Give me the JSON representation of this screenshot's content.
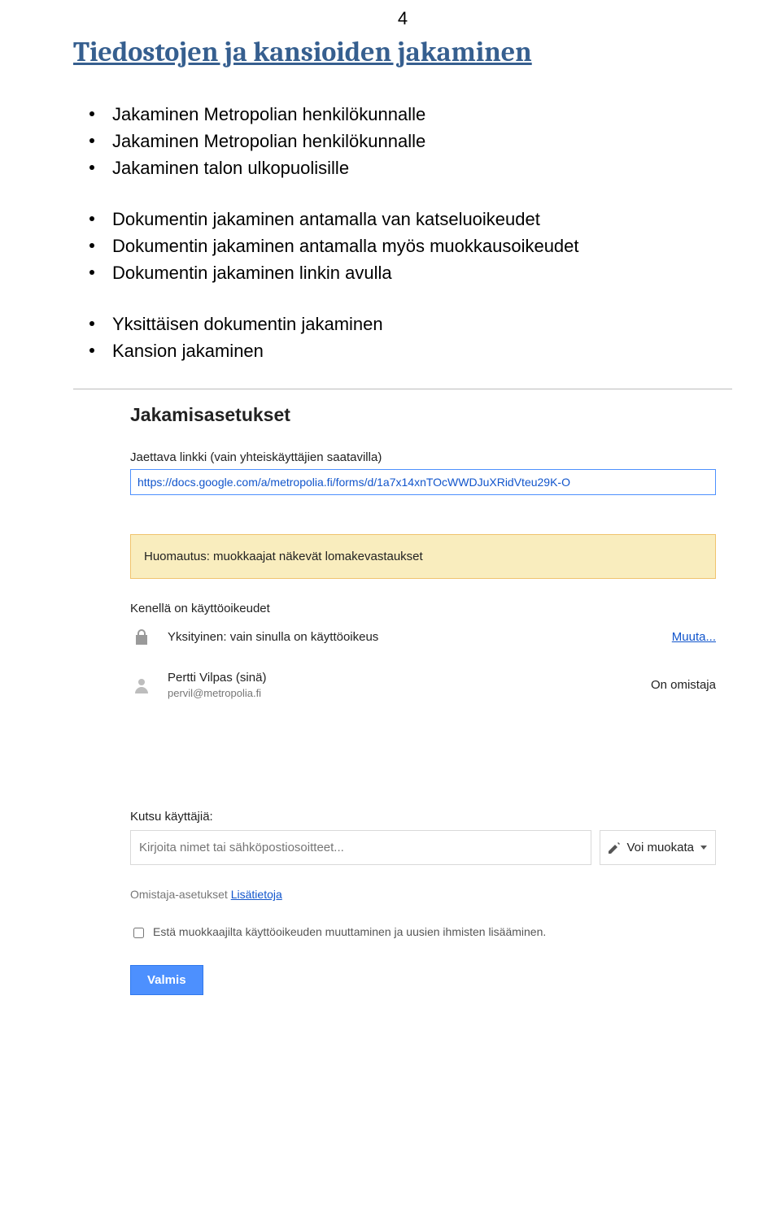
{
  "page_number": "4",
  "heading": "Tiedostojen ja kansioiden jakaminen",
  "group1": [
    "Jakaminen Metropolian henkilökunnalle",
    "Jakaminen Metropolian henkilökunnalle",
    "Jakaminen talon ulkopuolisille"
  ],
  "group2": [
    "Dokumentin jakaminen antamalla van katseluoikeudet",
    "Dokumentin jakaminen antamalla myös muokkausoikeudet",
    "Dokumentin jakaminen linkin avulla"
  ],
  "group3": [
    "Yksittäisen dokumentin jakaminen",
    "Kansion jakaminen"
  ],
  "dialog": {
    "title": "Jakamisasetukset",
    "link_label": "Jaettava linkki (vain yhteiskäyttäjien saatavilla)",
    "link_value": "https://docs.google.com/a/metropolia.fi/forms/d/1a7x14xnTOcWWDJuXRidVteu29K-O",
    "notice": "Huomautus: muokkaajat näkevät lomakevastaukset",
    "access_label": "Kenellä on käyttöoikeudet",
    "private_text": "Yksityinen: vain sinulla on käyttöoikeus",
    "change_link": "Muuta...",
    "owner_name": "Pertti Vilpas (sinä)",
    "owner_email": "pervil@metropolia.fi",
    "owner_role": "On omistaja",
    "invite_label": "Kutsu käyttäjiä:",
    "invite_placeholder": "Kirjoita nimet tai sähköpostiosoitteet...",
    "edit_dropdown": "Voi muokata",
    "owner_settings_prefix": "Omistaja-asetukset ",
    "owner_settings_link": "Lisätietoja",
    "checkbox_label": "Estä muokkaajilta käyttöoikeuden muuttaminen ja uusien ihmisten lisääminen.",
    "done_button": "Valmis"
  }
}
